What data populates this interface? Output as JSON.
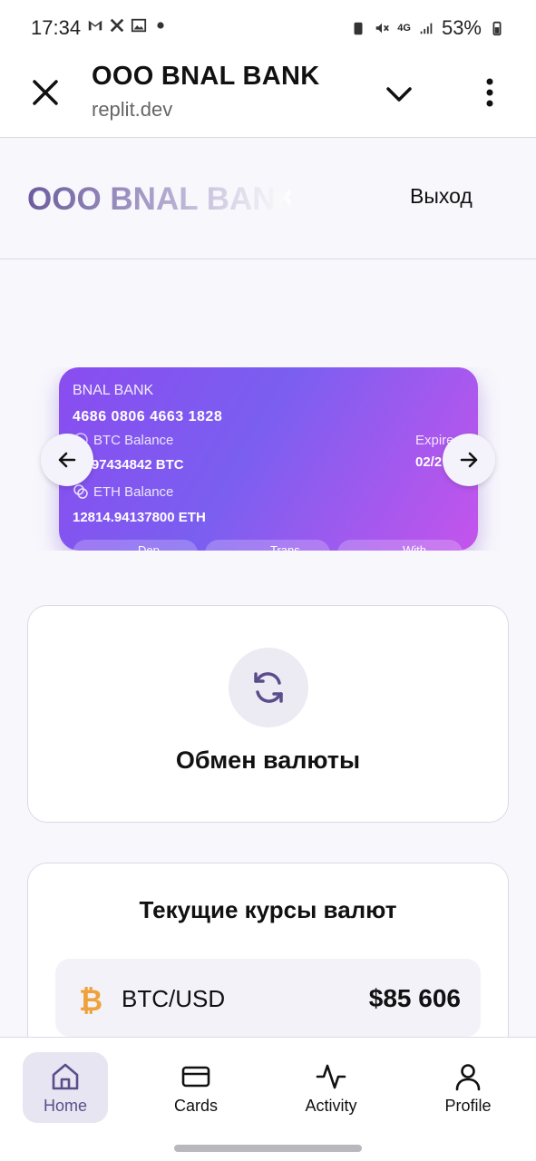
{
  "status_bar": {
    "time": "17:34",
    "battery": "53%",
    "network": "4G",
    "icons": [
      "gmail-icon",
      "tools-icon",
      "gallery-icon",
      "dot-icon",
      "battery-saver-icon",
      "mute-icon",
      "signal-icon",
      "battery-icon"
    ]
  },
  "browser": {
    "title": "OOO BNAL BANK",
    "url": "replit.dev"
  },
  "header": {
    "logo": "OOO BNAL BANK",
    "logout_label": "Выход"
  },
  "card": {
    "bank_name": "BNAL BANK",
    "number": "4686 0806 4663 1828",
    "btc_label": "BTC Balance",
    "btc_value": "87.97434842 BTC",
    "eth_label": "ETH Balance",
    "eth_value": "12814.94137800 ETH",
    "expires_label": "Expires",
    "expires_value": "02/2",
    "actions": [
      "Dep",
      "Trans",
      "With"
    ]
  },
  "exchange": {
    "label": "Обмен валюты"
  },
  "rates": {
    "title": "Текущие курсы валют",
    "items": [
      {
        "symbol": "₿",
        "pair": "BTC/USD",
        "price": "$85 606"
      }
    ]
  },
  "tabs": [
    {
      "label": "Home",
      "icon": "home-icon",
      "active": true
    },
    {
      "label": "Cards",
      "icon": "card-icon",
      "active": false
    },
    {
      "label": "Activity",
      "icon": "activity-icon",
      "active": false
    },
    {
      "label": "Profile",
      "icon": "profile-icon",
      "active": false
    }
  ],
  "colors": {
    "accent": "#5b4d8c",
    "card_gradient_start": "#8a4cf0",
    "card_gradient_end": "#c454ec",
    "btc_orange": "#f0a13a"
  }
}
